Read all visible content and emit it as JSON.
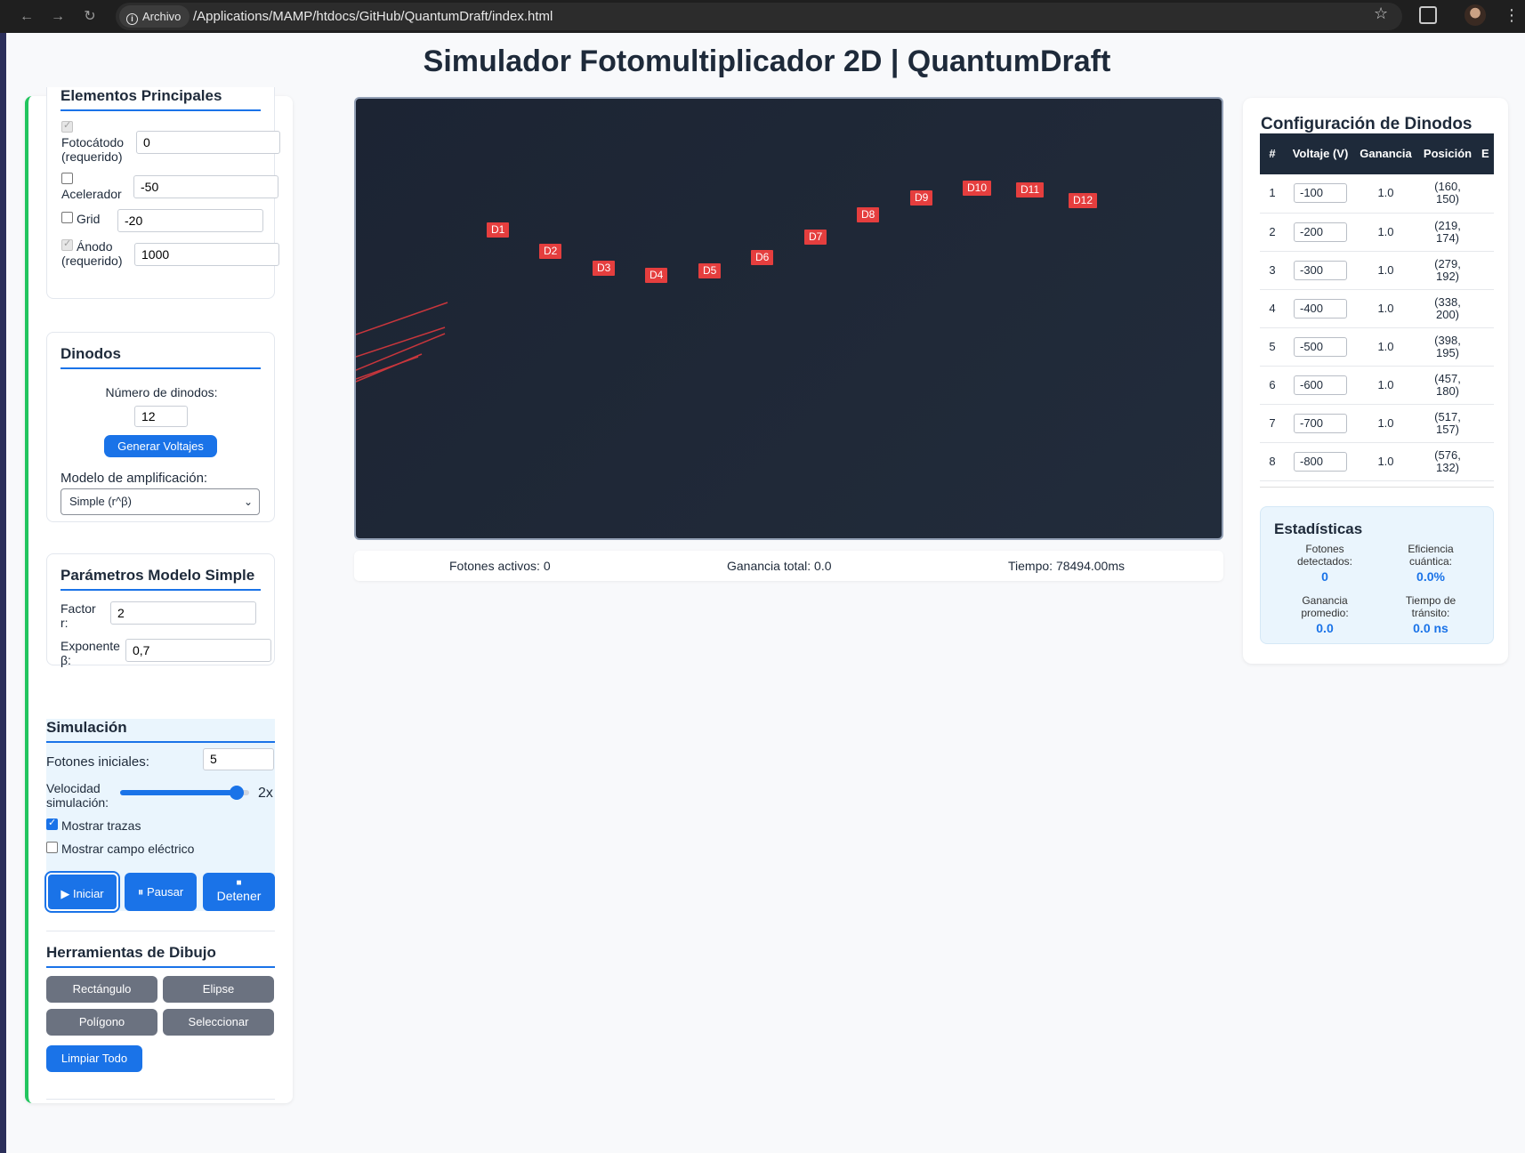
{
  "browser": {
    "site_chip": "Archivo",
    "url": "/Applications/MAMP/htdocs/GitHub/QuantumDraft/index.html"
  },
  "page": {
    "title": "Simulador Fotomultiplicador 2D | QuantumDraft"
  },
  "elements": {
    "title": "Elementos Principales",
    "photocathode": {
      "label": "Fotocátodo",
      "sub": "(requerido)",
      "value": "0"
    },
    "accelerator": {
      "label": "Acelerador",
      "value": "-50"
    },
    "grid": {
      "label": "Grid",
      "value": "-20"
    },
    "anode": {
      "label": "Ánodo",
      "sub": "(requerido)",
      "value": "1000"
    }
  },
  "dynodes": {
    "title": "Dinodos",
    "count_label": "Número de dinodos:",
    "count_value": "12",
    "generate_button": "Generar Voltajes",
    "model_label": "Modelo de amplificación:",
    "model_value": "Simple (r^β)"
  },
  "simple_model": {
    "title": "Parámetros Modelo Simple",
    "factor_label_1": "Factor",
    "factor_label_2": "r:",
    "factor_value": "2",
    "exponent_label_1": "Exponente",
    "exponent_label_2": "β:",
    "exponent_value": "0,7"
  },
  "simulation": {
    "title": "Simulación",
    "photons_label": "Fotones iniciales:",
    "photons_value": "5",
    "speed_label_1": "Velocidad",
    "speed_label_2": "simulación:",
    "speed_fraction": 0.9,
    "speed_value": "2x",
    "show_traces": "Mostrar trazas",
    "show_field": "Mostrar campo eléctrico",
    "start_button": "▶ Iniciar",
    "pause_button": "⏸ Pausar",
    "stop_icon": "■",
    "stop_button": "Detener"
  },
  "drawing": {
    "title": "Herramientas de Dibujo",
    "rectangle": "Rectángulo",
    "ellipse": "Elipse",
    "polygon": "Polígono",
    "select": "Seleccionar",
    "clear": "Limpiar Todo"
  },
  "canvas": {
    "dynode_labels": [
      "D1",
      "D2",
      "D3",
      "D4",
      "D5",
      "D6",
      "D7",
      "D8",
      "D9",
      "D10",
      "D11",
      "D12"
    ],
    "trace_color": "#c8363c",
    "dynode_color": "#e53e3e"
  },
  "status": {
    "active_photons": "Fotones activos: 0",
    "total_gain": "Ganancia total: 0.0",
    "time": "Tiempo: 78494.00ms"
  },
  "dynode_config": {
    "title": "Configuración de Dinodos",
    "headers": [
      "#",
      "Voltaje (V)",
      "Ganancia",
      "Posición",
      "E"
    ],
    "rows": [
      {
        "n": "1",
        "voltage": "-100",
        "gain": "1.0",
        "pos1": "(160,",
        "pos2": "150)"
      },
      {
        "n": "2",
        "voltage": "-200",
        "gain": "1.0",
        "pos1": "(219,",
        "pos2": "174)"
      },
      {
        "n": "3",
        "voltage": "-300",
        "gain": "1.0",
        "pos1": "(279,",
        "pos2": "192)"
      },
      {
        "n": "4",
        "voltage": "-400",
        "gain": "1.0",
        "pos1": "(338,",
        "pos2": "200)"
      },
      {
        "n": "5",
        "voltage": "-500",
        "gain": "1.0",
        "pos1": "(398,",
        "pos2": "195)"
      },
      {
        "n": "6",
        "voltage": "-600",
        "gain": "1.0",
        "pos1": "(457,",
        "pos2": "180)"
      },
      {
        "n": "7",
        "voltage": "-700",
        "gain": "1.0",
        "pos1": "(517,",
        "pos2": "157)"
      },
      {
        "n": "8",
        "voltage": "-800",
        "gain": "1.0",
        "pos1": "(576,",
        "pos2": "132)"
      }
    ]
  },
  "stats": {
    "title": "Estadísticas",
    "detected_label_1": "Fotones",
    "detected_label_2": "detectados:",
    "detected_value": "0",
    "efficiency_label_1": "Eficiencia",
    "efficiency_label_2": "cuántica:",
    "efficiency_value": "0.0%",
    "avg_gain_label_1": "Ganancia",
    "avg_gain_label_2": "promedio:",
    "avg_gain_value": "0.0",
    "transit_label_1": "Tiempo de",
    "transit_label_2": "tránsito:",
    "transit_value": "0.0 ns"
  }
}
